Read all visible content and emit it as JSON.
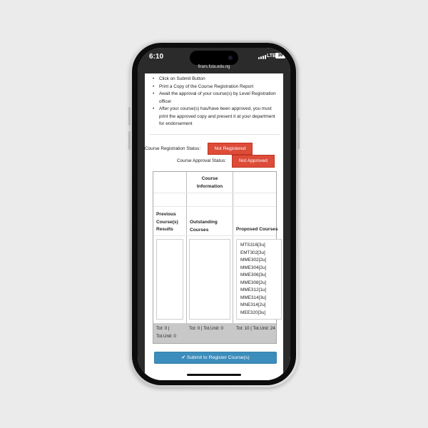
{
  "device": {
    "time": "6:10",
    "network": "LTE",
    "battery": "39",
    "url": "firars.futa.edu.ng"
  },
  "instructions": [
    "Click on Submit Button",
    "Print a Copy of the Course Registration Report",
    "Await the approval of your course(s) by Level Registration officer",
    "After your course(s) has/have been approved, you must print the approved copy and present it at your department for endorsement"
  ],
  "status": {
    "registration_label": "Course Registration Status:",
    "registration_value": "Not Registered",
    "approval_label": "Course Approval Status:",
    "approval_value": "Not Approved",
    "status_color": "#dd4b39"
  },
  "table": {
    "header_title": "Course Information",
    "columns": [
      "Previous Course(s) Results",
      "Outstanding Courses",
      "Proposed Courses"
    ],
    "previous_courses": [],
    "outstanding_courses": [],
    "proposed_courses": [
      "MTS316[3u]",
      "EMT302[3u]",
      "MME302[2u]",
      "MME304[2u]",
      "MME306[3u]",
      "MME308[2u]",
      "MME312[1u]",
      "MME314[3u]",
      "MNE314[2u]",
      "MEE320[3u]"
    ],
    "totals": [
      "Tot: 0 | Tot.Unit: 0",
      "Tot: 0 | Tot.Unit: 0",
      "Tot: 10 | Tot.Unit: 24"
    ]
  },
  "submit": {
    "label": "Submit to Register Course(s)",
    "icon": "check-icon",
    "color": "#3c8dbc"
  }
}
